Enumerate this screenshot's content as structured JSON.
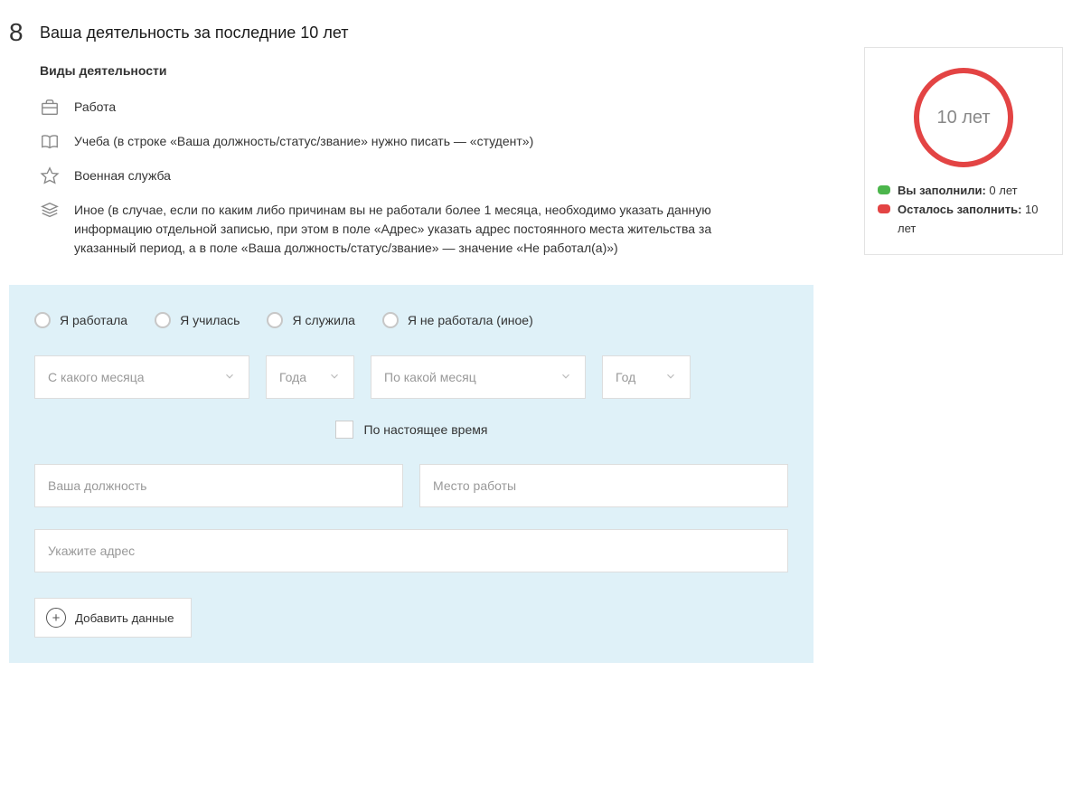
{
  "step_number": "8",
  "heading": "Ваша деятельность за последние 10 лет",
  "subheading": "Виды деятельности",
  "activity_types": {
    "work": "Работа",
    "study": "Учеба (в строке «Ваша должность/статус/звание» нужно писать — «студент»)",
    "military": "Военная служба",
    "other": "Иное (в случае, если по каким либо причинам вы не работали более 1 месяца, необходимо указать данную информацию отдельной записью, при этом в поле «Адрес» указать адрес постоянного места жительства за указанный период, а в поле «Ваша должность/статус/звание» — значение «Не работал(а)»)"
  },
  "radios": {
    "worked": "Я работала",
    "studied": "Я училась",
    "served": "Я служила",
    "not_worked": "Я не работала (иное)"
  },
  "selects": {
    "from_month": "С какого месяца",
    "from_year": "Года",
    "to_month": "По какой месяц",
    "to_year": "Год"
  },
  "present_label": "По настоящее время",
  "inputs": {
    "position": "Ваша должность",
    "workplace": "Место работы",
    "address": "Укажите адрес"
  },
  "add_button": "Добавить данные",
  "widget": {
    "ring_label": "10 лет",
    "filled_label": "Вы заполнили:",
    "filled_value": " 0 лет",
    "remaining_label": "Осталось заполнить:",
    "remaining_value": " 10 лет"
  }
}
